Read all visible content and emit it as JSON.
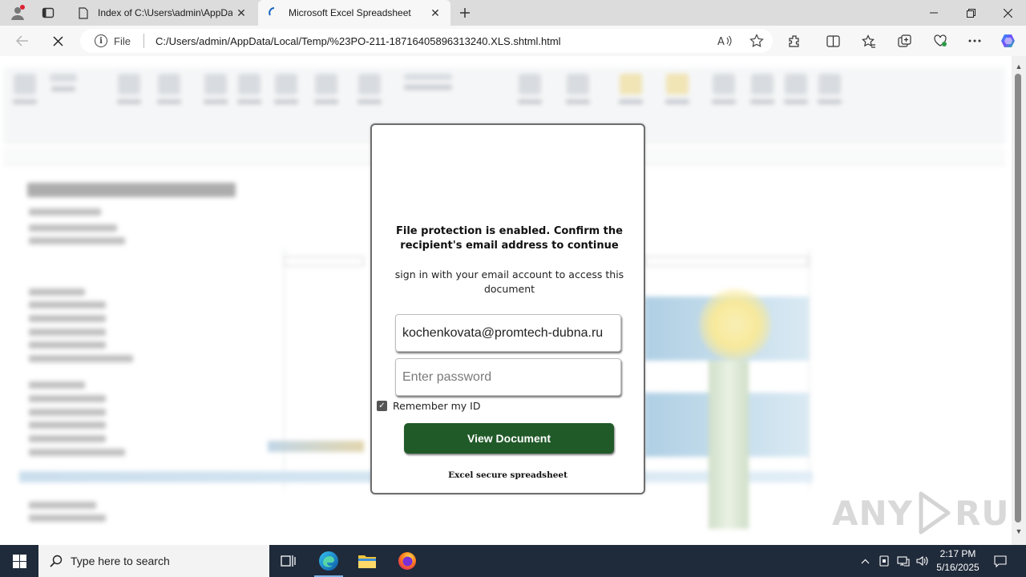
{
  "browser": {
    "tabs": [
      {
        "label": "Index of C:\\Users\\admin\\AppData",
        "active": false
      },
      {
        "label": "Microsoft Excel Spreadsheet",
        "active": true
      }
    ],
    "address": {
      "scheme_label": "File",
      "url": "C:/Users/admin/AppData/Local/Temp/%23PO-211-18716405896313240.XLS.shtml.html"
    }
  },
  "dialog": {
    "heading": "File protection is enabled. Confirm the recipient's email address to continue",
    "subheading": "sign in with your email account to access this document",
    "email_value": "kochenkovata@promtech-dubna.ru",
    "password_placeholder": "Enter password",
    "remember_label": "Remember my ID",
    "remember_checked": true,
    "submit_label": "View Document",
    "footer": "Excel secure spreadsheet",
    "accent_color": "#215a29"
  },
  "watermark": {
    "left": "ANY",
    "right": "RUN"
  },
  "taskbar": {
    "search_placeholder": "Type here to search",
    "time": "2:17 PM",
    "date": "5/16/2025"
  }
}
